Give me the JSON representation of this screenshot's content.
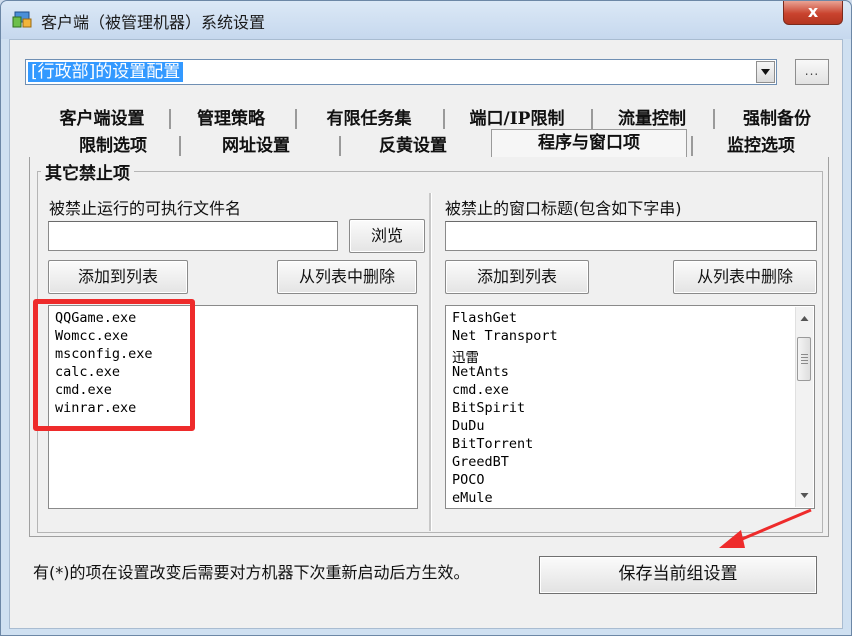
{
  "window": {
    "title": "客户端（被管理机器）系统设置",
    "close_label": "x"
  },
  "group_selector": {
    "selected": "[行政部]的设置配置",
    "more_label": "..."
  },
  "tabs": {
    "row1": [
      "客户端设置",
      "管理策略",
      "有限任务集",
      "端口/IP限制",
      "流量控制",
      "强制备份"
    ],
    "row2": [
      "限制选项",
      "网址设置",
      "反黄设置",
      "程序与窗口项",
      "监控选项"
    ],
    "active": "程序与窗口项"
  },
  "group": {
    "title": "其它禁止项"
  },
  "left": {
    "label": "被禁止运行的可执行文件名",
    "browse_label": "浏览",
    "add_label": "添加到列表",
    "remove_label": "从列表中删除",
    "items": [
      "QQGame.exe",
      "Womcc.exe",
      "msconfig.exe",
      "calc.exe",
      "cmd.exe",
      "winrar.exe"
    ]
  },
  "right": {
    "label": "被禁止的窗口标题(包含如下字串)",
    "add_label": "添加到列表",
    "remove_label": "从列表中删除",
    "items": [
      "FlashGet",
      "Net Transport",
      "迅雷",
      "NetAnts",
      "cmd.exe",
      "BitSpirit",
      "DuDu",
      "BitTorrent",
      "GreedBT",
      "POCO",
      "eMule"
    ]
  },
  "footer": {
    "note": "有(*)的项在设置改变后需要对方机器下次重新启动后方生效。",
    "save_label": "保存当前组设置"
  },
  "colors": {
    "highlight": "#ee2b2b",
    "selection": "#3399ff",
    "close": "#c9432e"
  }
}
